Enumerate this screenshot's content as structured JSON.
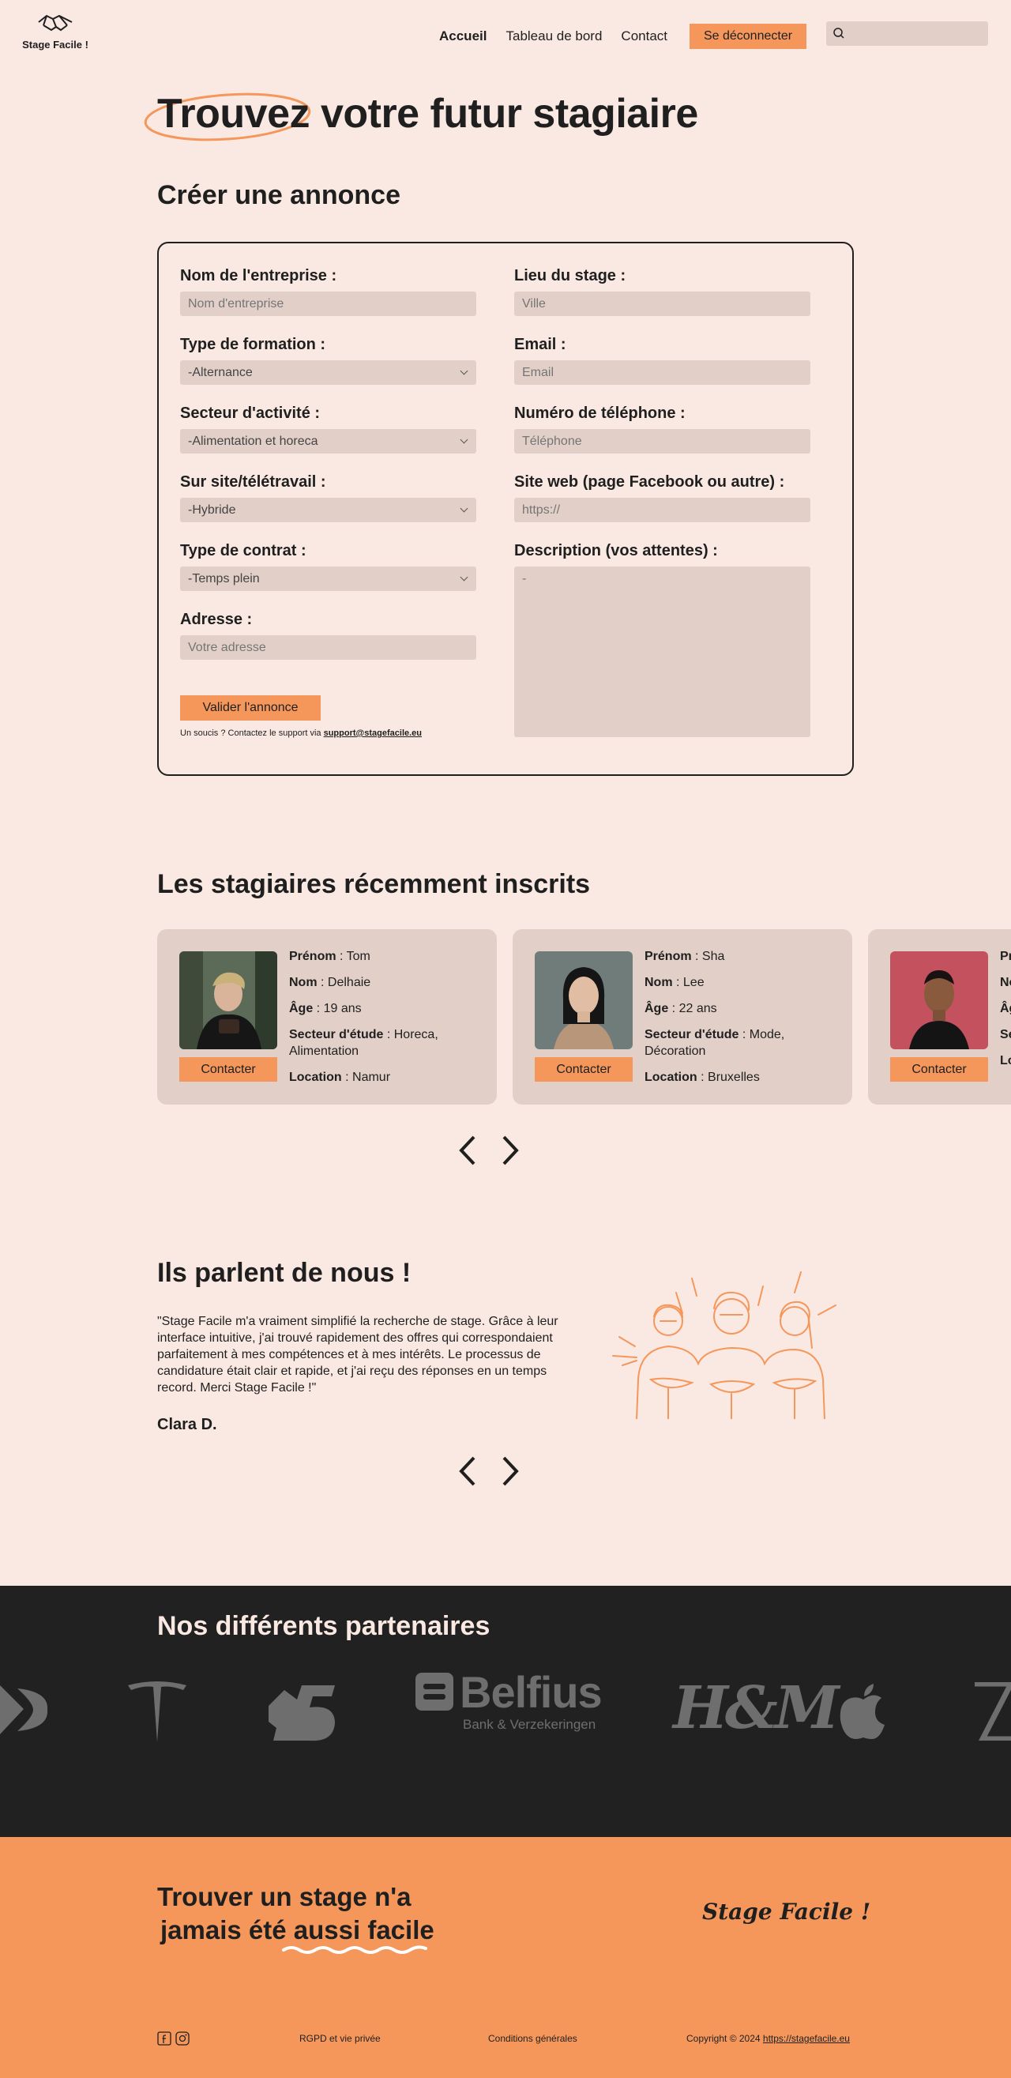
{
  "nav": {
    "logo_text": "Stage Facile !",
    "links": [
      "Accueil",
      "Tableau de bord",
      "Contact"
    ],
    "logout_label": "Se déconnecter"
  },
  "hero": {
    "title": "Trouvez votre futur stagiaire"
  },
  "form": {
    "title": "Créer une annonce",
    "company_label": "Nom de l'entreprise  :",
    "company_placeholder": "Nom d'entreprise",
    "formation_label": "Type de formation :",
    "formation_value": "-Alternance",
    "sector_label": "Secteur d'activité :",
    "sector_value": "-Alimentation et horeca",
    "remote_label": "Sur site/télétravail :",
    "remote_value": "-Hybride",
    "contract_label": "Type de contrat :",
    "contract_value": "-Temps plein",
    "address_label": "Adresse :",
    "address_placeholder": "Votre adresse",
    "location_label": "Lieu du stage :",
    "location_placeholder": "Ville",
    "email_label": "Email :",
    "email_placeholder": "Email",
    "phone_label": "Numéro de téléphone :",
    "phone_placeholder": "Téléphone",
    "website_label": "Site web (page Facebook ou autre) :",
    "website_placeholder": "https://",
    "description_label": "Description (vos attentes) :",
    "description_placeholder": "-",
    "submit_label": "Valider l'annonce",
    "support_text": "Un soucis ? Contactez le support via ",
    "support_email": "support@stagefacile.eu"
  },
  "interns": {
    "title": "Les stagiaires récemment inscrits",
    "labels": {
      "firstname": "Prénom",
      "lastname": "Nom",
      "age": "Âge",
      "sector": "Secteur d'étude",
      "location": "Location"
    },
    "contact_label": "Contacter",
    "cards": [
      {
        "firstname": "Tom",
        "lastname": "Delhaie",
        "age": "19 ans",
        "sector": "Horeca, Alimentation",
        "location": "Namur"
      },
      {
        "firstname": "Sha",
        "lastname": "Lee",
        "age": "22 ans",
        "sector": "Mode, Décoration",
        "location": "Bruxelles"
      },
      {
        "firstname": "",
        "lastname": "",
        "age": "",
        "sector": "",
        "location": ""
      }
    ]
  },
  "testimonials": {
    "title": "Ils parlent de nous !",
    "quote": "\"Stage Facile m'a vraiment simplifié la recherche de stage. Grâce à leur interface intuitive, j'ai trouvé rapidement des offres qui correspondaient parfaitement à mes compétences et à mes intérêts. Le processus de candidature était clair et rapide, et j'ai reçu des réponses en un temps record. Merci Stage Facile !\"",
    "author": "Clara D."
  },
  "partners": {
    "title": "Nos différents partenaires",
    "logos": [
      "Belfius",
      "Bank & Verzekeringen",
      "H&M"
    ]
  },
  "footer": {
    "tagline_1": "Trouver un stage n'a",
    "tagline_2a": "jamais été ",
    "tagline_2b": "aussi facile",
    "brand": "Stage Facile !",
    "privacy": "RGPD et vie privée",
    "terms": "Conditions générales",
    "copyright": "Copyright © 2024 ",
    "copyright_link": "https://stagefacile.eu"
  },
  "colors": {
    "background": "#f9e9e2",
    "accent": "#f5975b",
    "field": "#e2d0c8",
    "dark": "#212121"
  }
}
